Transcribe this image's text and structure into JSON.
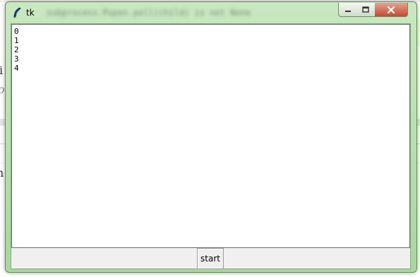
{
  "window": {
    "title": "tk",
    "blurred_title": "subprocess.Popen.poll(child) is not None",
    "controls": {
      "minimize": "minimize-icon",
      "maximize": "maximize-icon",
      "close": "close-icon"
    }
  },
  "output": {
    "lines": [
      "0",
      "1",
      "2",
      "3",
      "4"
    ]
  },
  "button": {
    "start_label": "start"
  },
  "background": {
    "char1": "i",
    "char2": "o",
    "char3": "n"
  },
  "colors": {
    "window_frame": "#a8d69d",
    "close_button": "#c24a34"
  }
}
